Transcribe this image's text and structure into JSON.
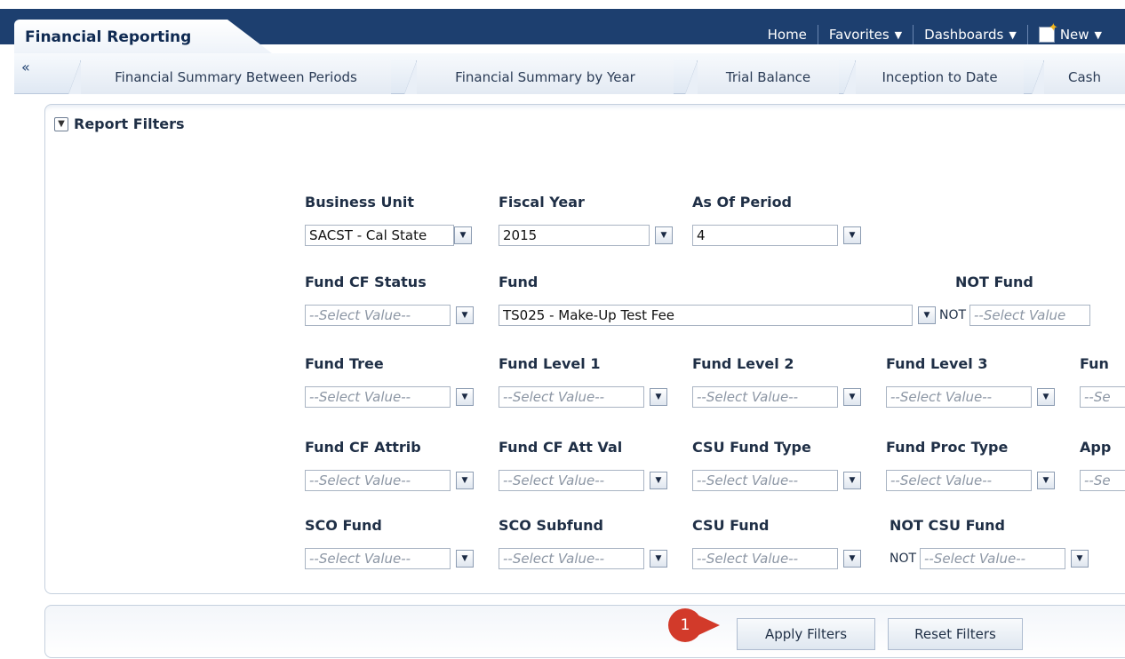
{
  "header": {
    "app_title": "Financial Reporting",
    "nav": {
      "home": "Home",
      "favorites": "Favorites",
      "dashboards": "Dashboards",
      "new": "New"
    }
  },
  "tabs": [
    {
      "label": "Financial Summary Between Periods"
    },
    {
      "label": "Financial Summary by Year"
    },
    {
      "label": "Trial Balance"
    },
    {
      "label": "Inception to Date"
    },
    {
      "label": "Cash"
    }
  ],
  "panel": {
    "title": "Report Filters",
    "not_label": "NOT",
    "filters": {
      "business_unit": {
        "label": "Business Unit",
        "value": "SACST - Cal State"
      },
      "fiscal_year": {
        "label": "Fiscal Year",
        "value": "2015"
      },
      "as_of_period": {
        "label": "As Of Period",
        "value": "4"
      },
      "fund_cf_status": {
        "label": "Fund CF Status",
        "value": "--Select Value--"
      },
      "fund": {
        "label": "Fund",
        "value": "TS025 - Make-Up Test Fee"
      },
      "not_fund": {
        "label": "NOT Fund",
        "value": "--Select Value"
      },
      "fund_tree": {
        "label": "Fund Tree",
        "value": "--Select Value--"
      },
      "fund_level_1": {
        "label": "Fund Level 1",
        "value": "--Select Value--"
      },
      "fund_level_2": {
        "label": "Fund Level 2",
        "value": "--Select Value--"
      },
      "fund_level_3": {
        "label": "Fund Level 3",
        "value": "--Select Value--"
      },
      "fund_level_4_partial": {
        "label": "Fun",
        "value": "--Se"
      },
      "fund_cf_attrib": {
        "label": "Fund CF Attrib",
        "value": "--Select Value--"
      },
      "fund_cf_att_val": {
        "label": "Fund CF Att Val",
        "value": "--Select Value--"
      },
      "csu_fund_type": {
        "label": "CSU Fund Type",
        "value": "--Select Value--"
      },
      "fund_proc_type": {
        "label": "Fund Proc Type",
        "value": "--Select Value--"
      },
      "app_partial": {
        "label": "App",
        "value": "--Se"
      },
      "sco_fund": {
        "label": "SCO Fund",
        "value": "--Select Value--"
      },
      "sco_subfund": {
        "label": "SCO Subfund",
        "value": "--Select Value--"
      },
      "csu_fund": {
        "label": "CSU Fund",
        "value": "--Select Value--"
      },
      "not_csu_fund": {
        "label": "NOT CSU Fund",
        "value": "--Select Value--"
      }
    }
  },
  "buttons": {
    "apply": "Apply Filters",
    "reset": "Reset Filters"
  },
  "callout": {
    "number": "1"
  },
  "colors": {
    "header_bg": "#1d3f6f",
    "callout": "#d23a2a"
  },
  "icons": {
    "collapse": "double-chevron-left-icon",
    "dropdown": "chevron-down-icon",
    "new": "new-document-icon",
    "disclosure": "collapse-panel-icon"
  }
}
